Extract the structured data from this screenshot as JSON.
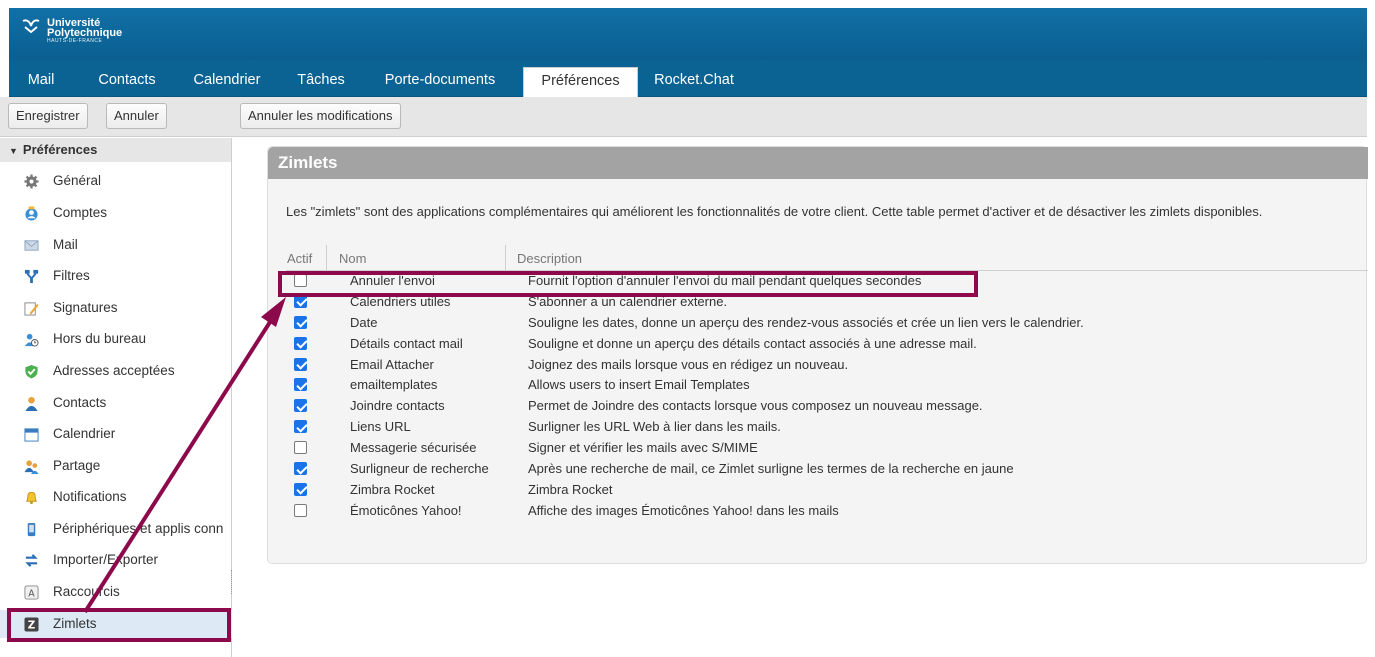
{
  "header": {
    "logo": {
      "line1": "Université",
      "line2": "Polytechnique",
      "line3": "HAUTS-DE-FRANCE"
    }
  },
  "tabs": [
    {
      "label": "Mail",
      "active": false
    },
    {
      "label": "Contacts",
      "active": false
    },
    {
      "label": "Calendrier",
      "active": false
    },
    {
      "label": "Tâches",
      "active": false
    },
    {
      "label": "Porte-documents",
      "active": false
    },
    {
      "label": "Préférences",
      "active": true
    },
    {
      "label": "Rocket.Chat",
      "active": false
    }
  ],
  "toolbar": {
    "save_label": "Enregistrer",
    "cancel_label": "Annuler",
    "undo_changes_label": "Annuler les modifications"
  },
  "sidebar": {
    "title": "Préférences",
    "items": [
      {
        "label": "Général",
        "icon": "gear-icon"
      },
      {
        "label": "Comptes",
        "icon": "accounts-icon"
      },
      {
        "label": "Mail",
        "icon": "mail-icon"
      },
      {
        "label": "Filtres",
        "icon": "filter-icon"
      },
      {
        "label": "Signatures",
        "icon": "signature-icon"
      },
      {
        "label": "Hors du bureau",
        "icon": "out-of-office-icon"
      },
      {
        "label": "Adresses acceptées",
        "icon": "shield-icon"
      },
      {
        "label": "Contacts",
        "icon": "contact-icon"
      },
      {
        "label": "Calendrier",
        "icon": "calendar-icon"
      },
      {
        "label": "Partage",
        "icon": "sharing-icon"
      },
      {
        "label": "Notifications",
        "icon": "bell-icon"
      },
      {
        "label": "Périphériques et applis conn",
        "icon": "device-icon"
      },
      {
        "label": "Importer/Exporter",
        "icon": "import-export-icon"
      },
      {
        "label": "Raccourcis",
        "icon": "shortcut-icon"
      },
      {
        "label": "Zimlets",
        "icon": "zimlet-icon",
        "selected": true
      }
    ]
  },
  "main": {
    "title": "Zimlets",
    "description": "Les \"zimlets\" sont des applications complémentaires qui améliorent les fonctionnalités de votre client. Cette table permet d'activer et de désactiver les zimlets disponibles.",
    "columns": [
      "Actif",
      "Nom",
      "Description"
    ],
    "rows": [
      {
        "active": false,
        "name": "Annuler l'envoi",
        "description": "Fournit l'option d'annuler l'envoi du mail pendant quelques secondes"
      },
      {
        "active": true,
        "name": "Calendriers utiles",
        "description": "S'abonner a un calendrier externe."
      },
      {
        "active": true,
        "name": "Date",
        "description": "Souligne les dates, donne un aperçu des rendez-vous associés et crée un lien vers le calendrier."
      },
      {
        "active": true,
        "name": "Détails contact mail",
        "description": "Souligne et donne un aperçu des détails contact associés à une adresse mail."
      },
      {
        "active": true,
        "name": "Email Attacher",
        "description": "Joignez des mails lorsque vous en rédigez un nouveau."
      },
      {
        "active": true,
        "name": "emailtemplates",
        "description": "Allows users to insert Email Templates"
      },
      {
        "active": true,
        "name": "Joindre contacts",
        "description": "Permet de Joindre des contacts lorsque vous composez un nouveau message."
      },
      {
        "active": true,
        "name": "Liens URL",
        "description": "Surligner les URL Web à lier dans les mails."
      },
      {
        "active": false,
        "name": "Messagerie sécurisée",
        "description": "Signer et vérifier les mails avec S/MIME"
      },
      {
        "active": true,
        "name": "Surligneur de recherche",
        "description": "Après une recherche de mail, ce Zimlet surligne les termes de la recherche en jaune"
      },
      {
        "active": true,
        "name": "Zimbra Rocket",
        "description": "Zimbra Rocket"
      },
      {
        "active": false,
        "name": "Émoticônes Yahoo!",
        "description": "Affiche des images Émoticônes Yahoo! dans les mails"
      }
    ]
  },
  "colors": {
    "brand": "#0b6394",
    "checkbox_checked": "#1a73e8",
    "annotation": "#8c0a4b",
    "selected_row": "#ddeaf5"
  }
}
